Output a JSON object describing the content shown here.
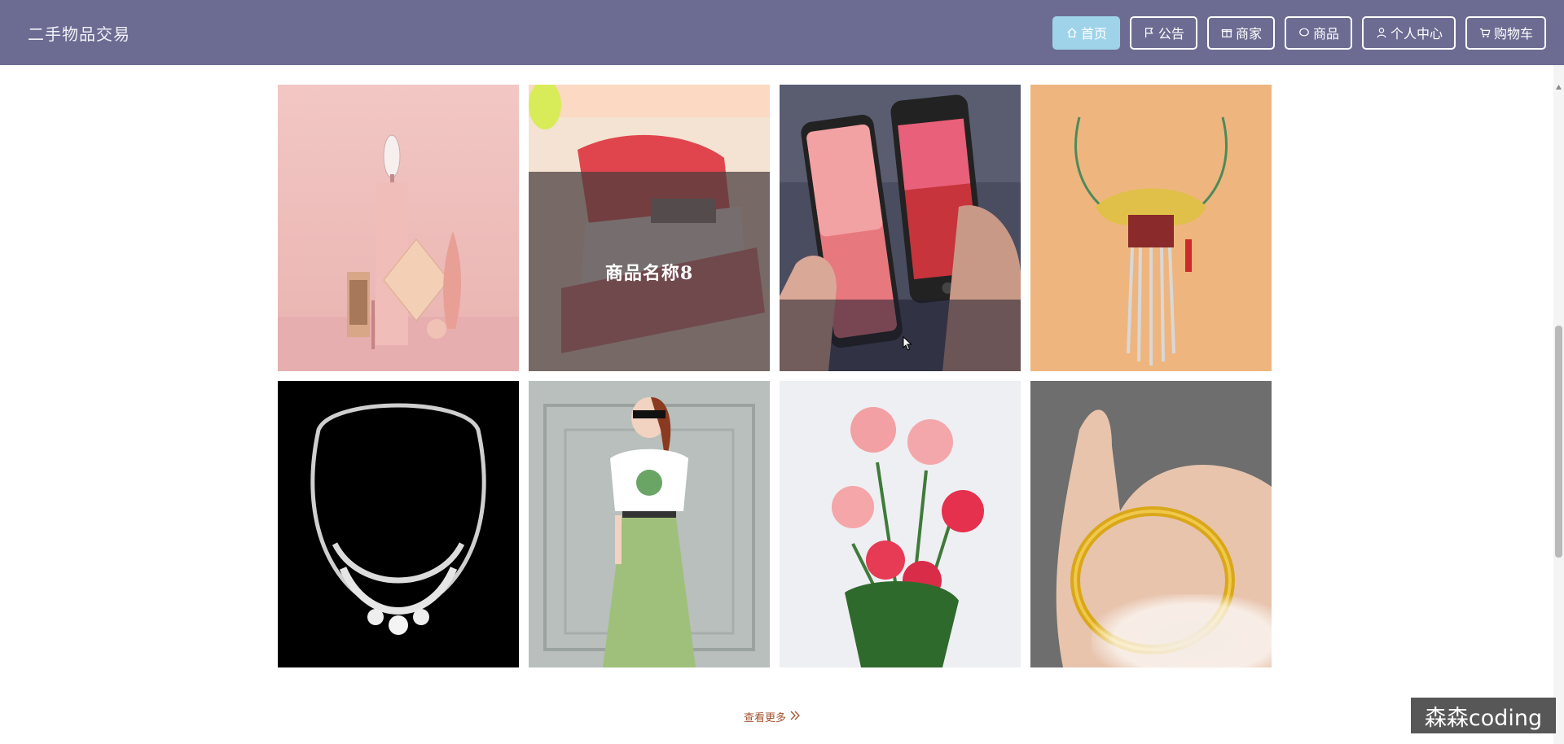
{
  "header": {
    "brand": "二手物品交易",
    "nav": [
      {
        "label": "首页",
        "icon": "home-icon",
        "active": true
      },
      {
        "label": "公告",
        "icon": "flag-icon",
        "active": false
      },
      {
        "label": "商家",
        "icon": "gift-icon",
        "active": false
      },
      {
        "label": "商品",
        "icon": "chat-bubble-icon",
        "active": false
      },
      {
        "label": "个人中心",
        "icon": "user-icon",
        "active": false
      },
      {
        "label": "购物车",
        "icon": "cart-icon",
        "active": false
      }
    ]
  },
  "products": [
    {
      "kind": "cosmetics-still-life",
      "overlay_title": ""
    },
    {
      "kind": "stapler",
      "overlay_title": "商品名称8"
    },
    {
      "kind": "smartphones",
      "overlay_title": ""
    },
    {
      "kind": "gold-necklace",
      "overlay_title": ""
    },
    {
      "kind": "diamond-necklace",
      "overlay_title": ""
    },
    {
      "kind": "woman-green-skirt",
      "overlay_title": ""
    },
    {
      "kind": "roses",
      "overlay_title": ""
    },
    {
      "kind": "gold-bangle",
      "overlay_title": ""
    }
  ],
  "see_more": {
    "label": "查看更多",
    "icon": "double-chevron-right-icon"
  },
  "watermark": {
    "text": "森森coding"
  },
  "colors": {
    "header_bg": "#6c6c93",
    "active_nav_bg": "#9fd3ea",
    "see_more_text": "#a0522d"
  }
}
